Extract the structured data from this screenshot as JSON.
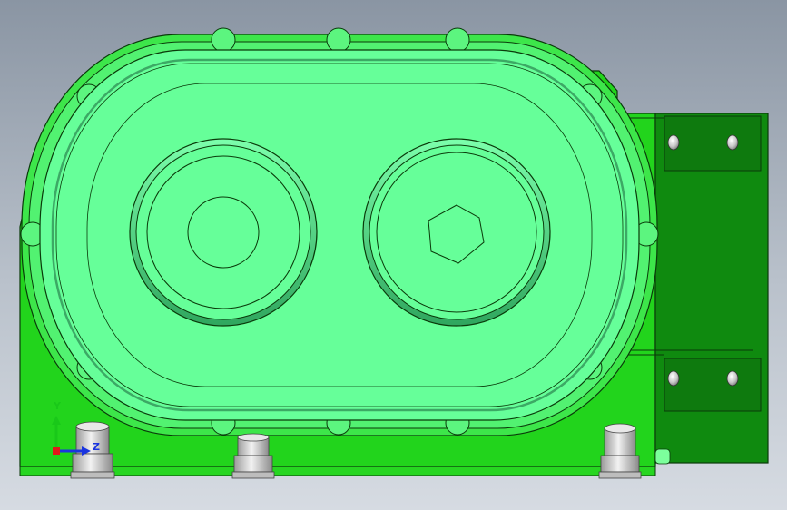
{
  "viewport": {
    "background_top": "#8a95a3",
    "background_bottom": "#d6dbe2"
  },
  "model": {
    "body_color": "#22d41c",
    "cover_color": "#66ff99",
    "bracket_color": "#0e7a0e",
    "outline_color": "#0a3a0a"
  },
  "triad": {
    "y_label": "Y",
    "z_label": "Z",
    "y_color": "#19c819",
    "z_color": "#1a35e0",
    "x_color": "#e01a1a"
  }
}
